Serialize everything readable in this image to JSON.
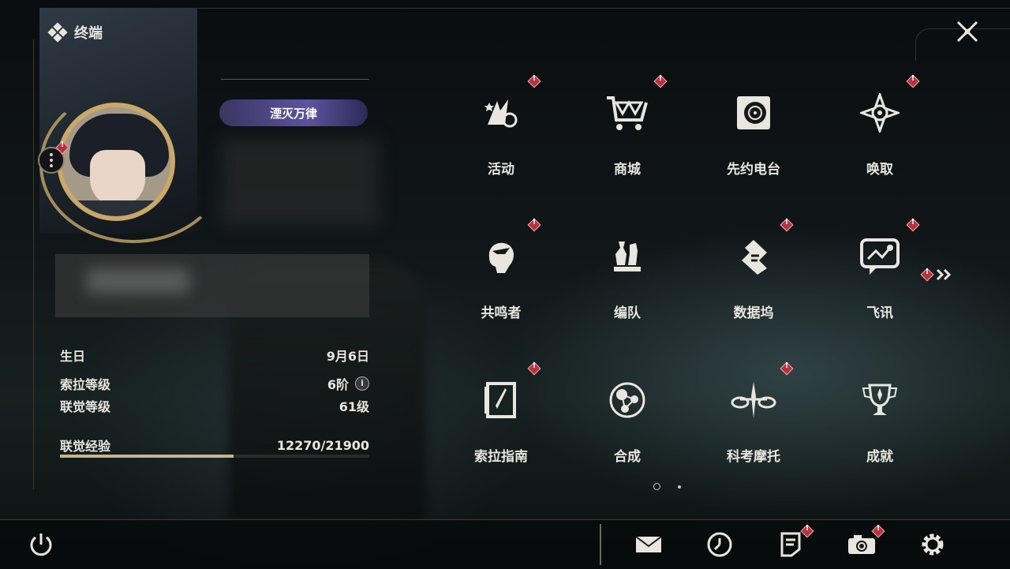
{
  "header": {
    "title": "终端"
  },
  "profile": {
    "badge_title": "湮灭万律",
    "stats": [
      {
        "label": "生日",
        "value": "9月6日"
      },
      {
        "label": "索拉等级",
        "value": "6阶"
      },
      {
        "label": "联觉等级",
        "value": "61级"
      }
    ],
    "xp": {
      "label": "联觉经验",
      "value": "12270/21900",
      "progress": 0.56
    }
  },
  "menu": [
    {
      "label": "活动",
      "icon": "event-icon"
    },
    {
      "label": "商城",
      "icon": "shop-cart-icon"
    },
    {
      "label": "先约电台",
      "icon": "radio-icon"
    },
    {
      "label": "唤取",
      "icon": "summon-compass-icon"
    },
    {
      "label": "共鸣者",
      "icon": "resonator-head-icon"
    },
    {
      "label": "编队",
      "icon": "chess-team-icon"
    },
    {
      "label": "数据坞",
      "icon": "data-dock-icon"
    },
    {
      "label": "飞讯",
      "icon": "message-icon"
    },
    {
      "label": "索拉指南",
      "icon": "guide-book-icon"
    },
    {
      "label": "合成",
      "icon": "synthesis-icon"
    },
    {
      "label": "科考摩托",
      "icon": "motorbike-icon"
    },
    {
      "label": "成就",
      "icon": "trophy-icon"
    }
  ],
  "bottom_icons": [
    "power-icon",
    "mail-icon",
    "clock-icon",
    "notes-icon",
    "camera-icon",
    "settings-icon"
  ],
  "colors": {
    "accent_gold": "#c9a86a",
    "alert_red": "#b5323f",
    "text": "#e9e6df"
  }
}
